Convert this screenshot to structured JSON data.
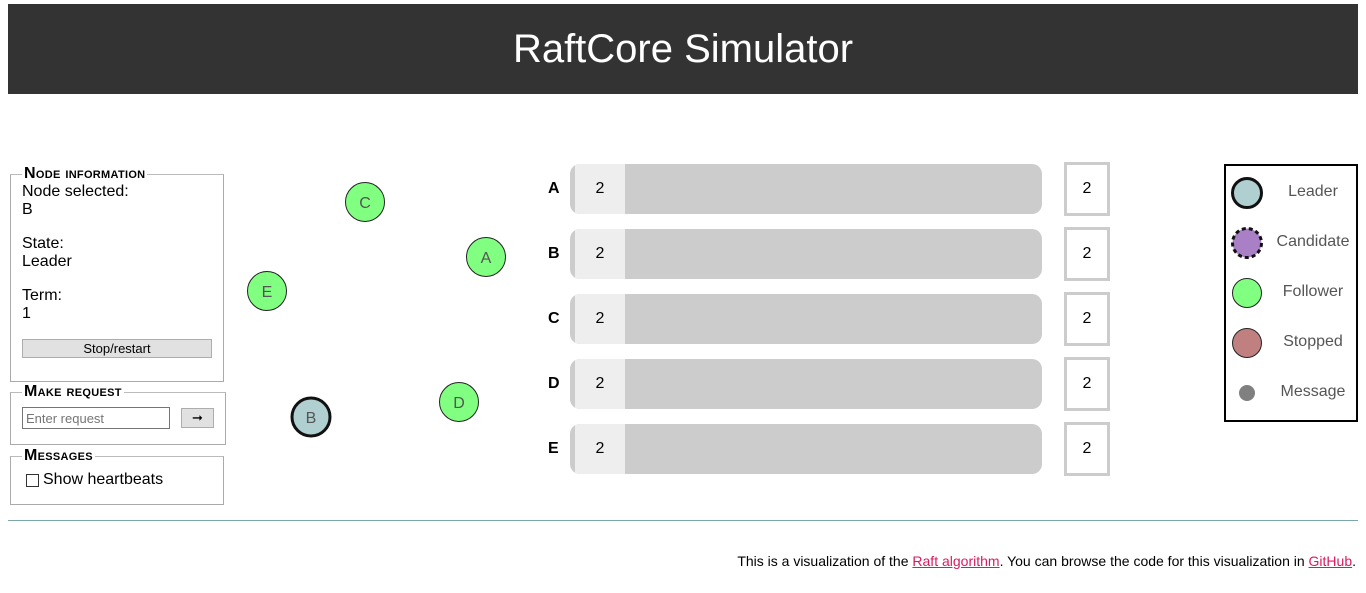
{
  "header": {
    "title": "RaftCore Simulator"
  },
  "node_info": {
    "legend": "Node information",
    "selected_label": "Node selected:",
    "selected_value": "B",
    "state_label": "State:",
    "state_value": "Leader",
    "term_label": "Term:",
    "term_value": "1",
    "stop_button": "Stop/restart"
  },
  "make_request": {
    "legend": "Make request",
    "input_value": "",
    "input_placeholder": "Enter request",
    "submit_icon": "arrow-right-icon",
    "submit_glyph": "➞"
  },
  "messages": {
    "legend": "Messages",
    "show_heartbeats_label": "Show heartbeats",
    "show_heartbeats_checked": false
  },
  "nodes": [
    {
      "id": "A",
      "state": "Follower"
    },
    {
      "id": "B",
      "state": "Leader"
    },
    {
      "id": "C",
      "state": "Follower"
    },
    {
      "id": "D",
      "state": "Follower"
    },
    {
      "id": "E",
      "state": "Follower"
    }
  ],
  "logs": [
    {
      "node": "A",
      "entries": [
        "2"
      ],
      "commit_index": "2"
    },
    {
      "node": "B",
      "entries": [
        "2"
      ],
      "commit_index": "2"
    },
    {
      "node": "C",
      "entries": [
        "2"
      ],
      "commit_index": "2"
    },
    {
      "node": "D",
      "entries": [
        "2"
      ],
      "commit_index": "2"
    },
    {
      "node": "E",
      "entries": [
        "2"
      ],
      "commit_index": "2"
    }
  ],
  "legend": [
    {
      "label": "Leader",
      "color": "#b0cfd0"
    },
    {
      "label": "Candidate",
      "color": "#a97fc6"
    },
    {
      "label": "Follower",
      "color": "#80ff80"
    },
    {
      "label": "Stopped",
      "color": "#c08080"
    },
    {
      "label": "Message",
      "color": "#808080"
    }
  ],
  "colors": {
    "header_bg": "#333333",
    "leader": "#b0cfd0",
    "follower": "#80ff80",
    "link": "#d81b60"
  },
  "footer": {
    "text_before": "This is a visualization of the ",
    "link1": "Raft algorithm",
    "text_middle": ". You can browse the code for this visualization in ",
    "link2": "GitHub",
    "text_after": "."
  }
}
